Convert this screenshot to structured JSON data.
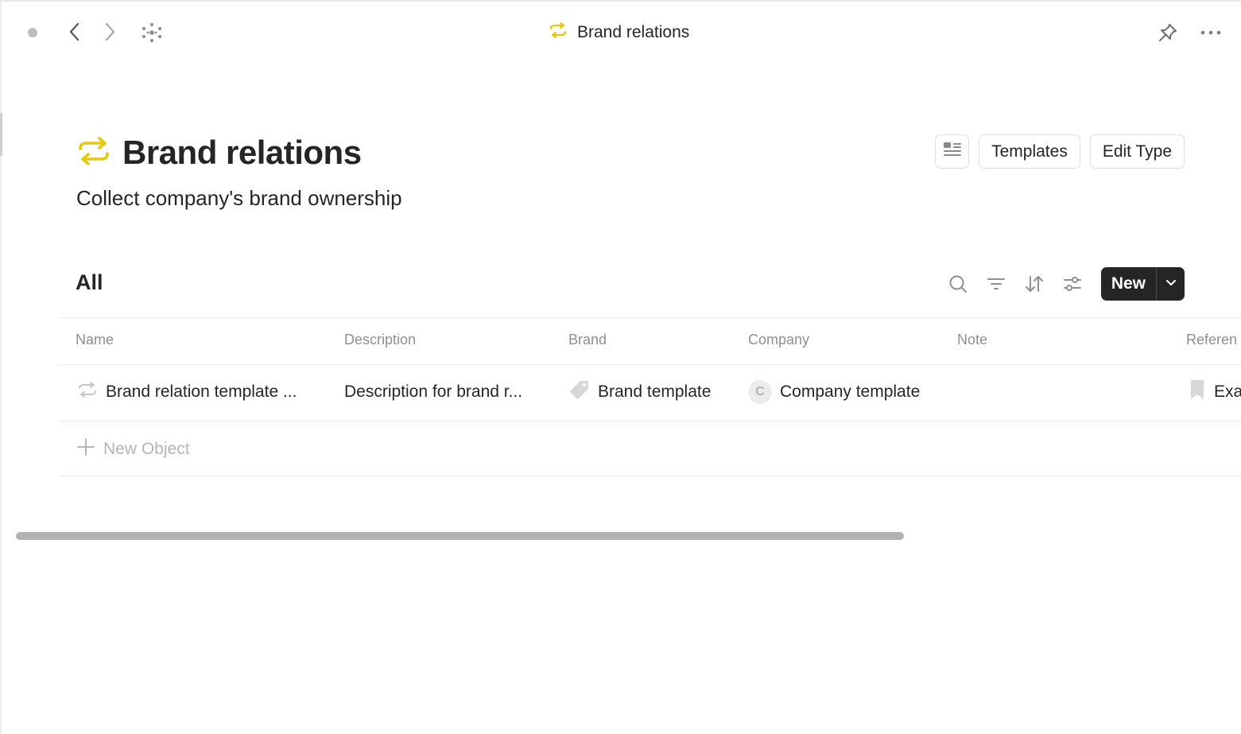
{
  "topbar": {
    "breadcrumb_title": "Brand relations",
    "icons": [
      "back-arrow-icon",
      "forward-arrow-icon",
      "graph-icon",
      "pin-icon",
      "more-icon"
    ]
  },
  "header": {
    "title": "Brand relations",
    "description": "Collect company's brand ownership",
    "layout_button_icon": "layout-icon",
    "templates_label": "Templates",
    "edit_type_label": "Edit Type"
  },
  "view": {
    "title": "All",
    "tools": [
      "search-icon",
      "filter-icon",
      "sort-icon",
      "settings-icon"
    ],
    "new_label": "New"
  },
  "table": {
    "columns": [
      "Name",
      "Description",
      "Brand",
      "Company",
      "Note",
      "Referen"
    ],
    "rows": [
      {
        "name": "Brand relation template ...",
        "description": "Description for brand r...",
        "brand": "Brand template",
        "company_initial": "C",
        "company": "Company template",
        "note": "",
        "reference": "Exa"
      }
    ],
    "new_object_label": "New Object"
  },
  "colors": {
    "accent_yellow": "#e3c90d",
    "text": "#252525",
    "muted": "#8f8f8f",
    "button_dark": "#252525"
  }
}
